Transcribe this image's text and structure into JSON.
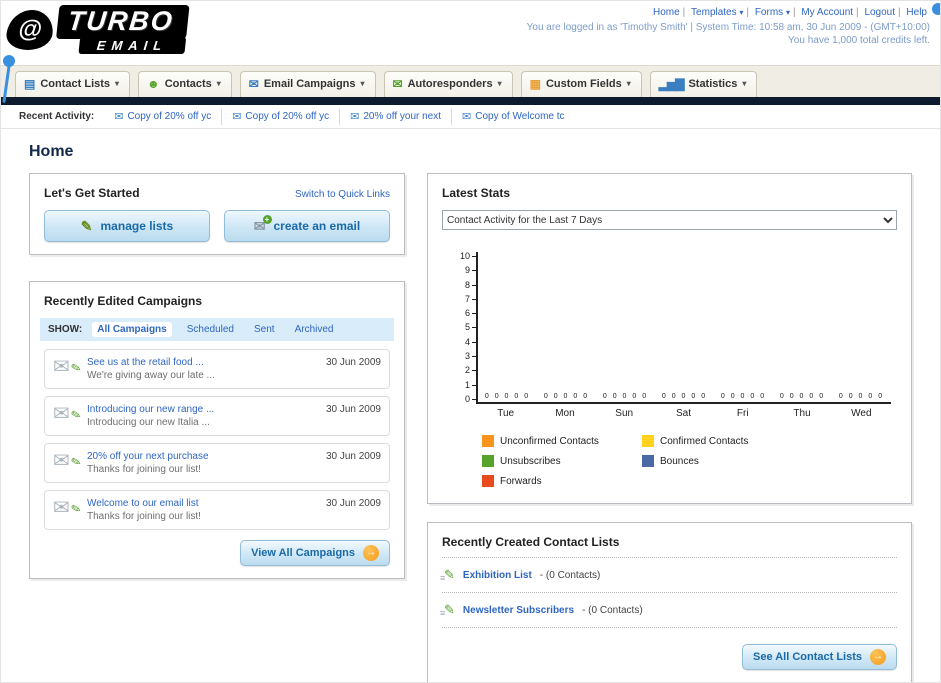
{
  "header": {
    "logo": {
      "title": "TURBO",
      "subtitle": "EMAIL",
      "swirl_icon": "@"
    },
    "nav": [
      {
        "label": "Home",
        "has_caret": false
      },
      {
        "label": "Templates",
        "has_caret": true
      },
      {
        "label": "Forms",
        "has_caret": true
      },
      {
        "label": "My Account",
        "has_caret": false
      },
      {
        "label": "Logout",
        "has_caret": false
      },
      {
        "label": "Help",
        "has_caret": false
      }
    ],
    "login_info": "You are logged in as 'Timothy Smith' | System Time: 10:58 am, 30 Jun 2009 - (GMT+10:00)",
    "credits": "You have 1,000 total credits left."
  },
  "nav_tabs": [
    {
      "label": "Contact Lists",
      "icon": "contact-lists-icon",
      "glyph": "▤"
    },
    {
      "label": "Contacts",
      "icon": "contacts-icon",
      "glyph": "☻"
    },
    {
      "label": "Email Campaigns",
      "icon": "email-campaigns-icon",
      "glyph": "✉"
    },
    {
      "label": "Autoresponders",
      "icon": "autoresponders-icon",
      "glyph": "✉"
    },
    {
      "label": "Custom Fields",
      "icon": "custom-fields-icon",
      "glyph": "▦"
    },
    {
      "label": "Statistics",
      "icon": "statistics-icon",
      "glyph": "▂▅▇"
    }
  ],
  "recent_activity": {
    "label": "Recent Activity:",
    "items": [
      {
        "text": "Copy of 20% off yc"
      },
      {
        "text": "Copy of 20% off yc"
      },
      {
        "text": "20% off your next"
      },
      {
        "text": "Copy of Welcome tc"
      }
    ]
  },
  "page_title": "Home",
  "get_started": {
    "title": "Let's Get Started",
    "switch_link": "Switch to Quick Links",
    "manage_lists_label": "manage lists",
    "create_email_label": "create an email"
  },
  "campaigns": {
    "title": "Recently Edited Campaigns",
    "show_label": "SHOW:",
    "tabs": [
      {
        "label": "All Campaigns",
        "active": true
      },
      {
        "label": "Scheduled",
        "active": false
      },
      {
        "label": "Sent",
        "active": false
      },
      {
        "label": "Archived",
        "active": false
      }
    ],
    "items": [
      {
        "title": "See us at the retail food ...",
        "subtitle": "We're giving away our late ...",
        "date": "30 Jun 2009"
      },
      {
        "title": "Introducing our new range ...",
        "subtitle": "Introducing our new Italia ...",
        "date": "30 Jun 2009"
      },
      {
        "title": "20% off your next purchase",
        "subtitle": "Thanks for joining our list!",
        "date": "30 Jun 2009"
      },
      {
        "title": "Welcome to our email list",
        "subtitle": "Thanks for joining our list!",
        "date": "30 Jun 2009"
      }
    ],
    "view_all_label": "View All Campaigns",
    "arrow": "→"
  },
  "stats": {
    "title": "Latest Stats",
    "dropdown_value": "Contact Activity for the Last 7 Days",
    "chart_data": {
      "type": "bar",
      "title": "Contact Activity for the Last 7 Days",
      "categories": [
        "Tue",
        "Mon",
        "Sun",
        "Sat",
        "Fri",
        "Thu",
        "Wed"
      ],
      "series": [
        {
          "name": "Unconfirmed Contacts",
          "color": "#f7941d",
          "values": [
            0,
            0,
            0,
            0,
            0,
            0,
            0
          ]
        },
        {
          "name": "Confirmed Contacts",
          "color": "#ffd21e",
          "values": [
            0,
            0,
            0,
            0,
            0,
            0,
            0
          ]
        },
        {
          "name": "Unsubscribes",
          "color": "#56a22b",
          "values": [
            0,
            0,
            0,
            0,
            0,
            0,
            0
          ]
        },
        {
          "name": "Bounces",
          "color": "#4a69a5",
          "values": [
            0,
            0,
            0,
            0,
            0,
            0,
            0
          ]
        },
        {
          "name": "Forwards",
          "color": "#e8491d",
          "values": [
            0,
            0,
            0,
            0,
            0,
            0,
            0
          ]
        }
      ],
      "ylim": [
        0,
        10
      ],
      "y_ticks": [
        10,
        9,
        8,
        7,
        6,
        5,
        4,
        3,
        2,
        1,
        0
      ],
      "grid": false,
      "legend_position": "bottom"
    }
  },
  "contact_lists": {
    "title": "Recently Created Contact Lists",
    "items": [
      {
        "name": "Exhibition List",
        "detail": "- (0 Contacts)"
      },
      {
        "name": "Newsletter Subscribers",
        "detail": "- (0 Contacts)"
      }
    ],
    "see_all_label": "See All Contact Lists",
    "arrow": "→"
  }
}
